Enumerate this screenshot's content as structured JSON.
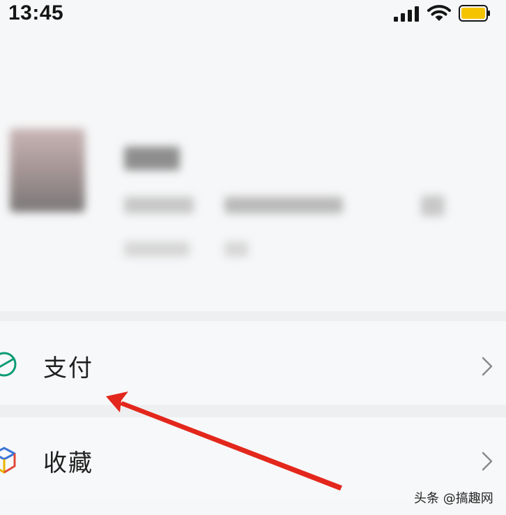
{
  "status_bar": {
    "time": "13:45",
    "icons": [
      "signal-icon",
      "wifi-icon",
      "battery-icon"
    ],
    "battery_color": "#f5c400"
  },
  "menu": {
    "items": [
      {
        "label": "支付",
        "icon": "payment-icon",
        "icon_color": "#0a9b74"
      },
      {
        "label": "收藏",
        "icon": "favorites-cube-icon",
        "icon_color": "#e8b400"
      }
    ]
  },
  "annotation": {
    "arrow_color": "#e3271c"
  },
  "watermark": {
    "text": "头条 @搞趣网"
  }
}
